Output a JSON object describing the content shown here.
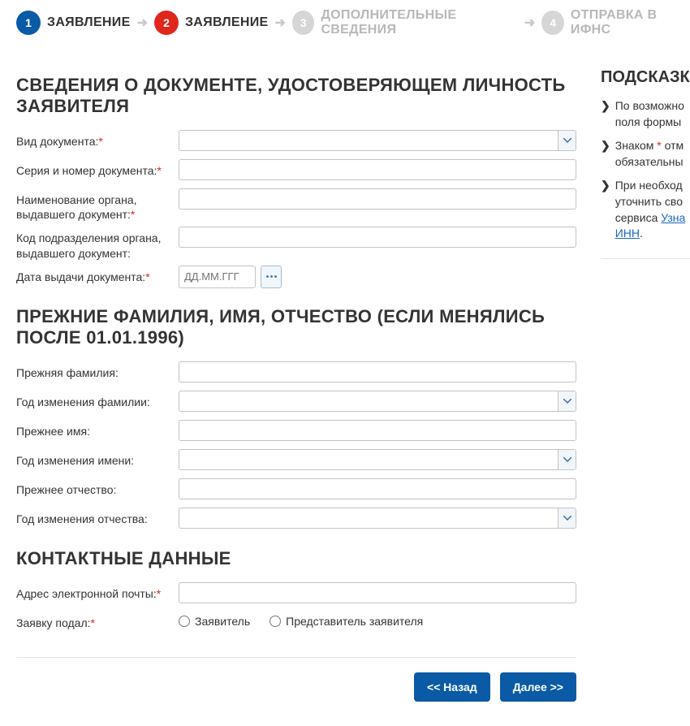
{
  "stepper": {
    "steps": [
      {
        "num": "1",
        "label": "ЗАЯВЛЕНИЕ",
        "circle": "circ-blue",
        "labelCls": "lbl-black"
      },
      {
        "num": "2",
        "label": "ЗАЯВЛЕНИЕ",
        "circle": "circ-red",
        "labelCls": "lbl-black"
      },
      {
        "num": "3",
        "label": "ДОПОЛНИТЕЛЬНЫЕ СВЕДЕНИЯ",
        "circle": "circ-grey",
        "labelCls": "lbl-grey"
      },
      {
        "num": "4",
        "label": "ОТПРАВКА В ИФНС",
        "circle": "circ-grey",
        "labelCls": "lbl-grey"
      }
    ]
  },
  "sections": {
    "doc": {
      "title": "СВЕДЕНИЯ О ДОКУМЕНТЕ, УДОСТОВЕРЯЮЩЕМ ЛИЧНОСТЬ ЗАЯВИТЕЛЯ",
      "fields": {
        "type": {
          "label": "Вид документа:",
          "req": "*"
        },
        "series": {
          "label": "Серия и номер документа:",
          "req": "*"
        },
        "issuer": {
          "label": "Наименование органа, выдавшего документ:",
          "req": "*"
        },
        "code": {
          "label": "Код подразделения органа, выдавшего документ:"
        },
        "date": {
          "label": "Дата выдачи документа:",
          "req": "*",
          "placeholder": "ДД.ММ.ГГГ"
        }
      }
    },
    "prev": {
      "title": "ПРЕЖНИЕ ФАМИЛИЯ, ИМЯ, ОТЧЕСТВО (ЕСЛИ МЕНЯЛИСЬ ПОСЛЕ 01.01.1996)",
      "fields": {
        "surname": {
          "label": "Прежняя фамилия:"
        },
        "surnameYear": {
          "label": "Год изменения фамилии:"
        },
        "name": {
          "label": "Прежнее имя:"
        },
        "nameYear": {
          "label": "Год изменения имени:"
        },
        "patr": {
          "label": "Прежнее отчество:"
        },
        "patrYear": {
          "label": "Год изменения отчества:"
        }
      }
    },
    "contact": {
      "title": "КОНТАКТНЫЕ ДАННЫЕ",
      "fields": {
        "email": {
          "label": "Адрес электронной почты:",
          "req": "*"
        },
        "submitter": {
          "label": "Заявку подал:",
          "req": "*",
          "options": {
            "self": "Заявитель",
            "rep": "Представитель заявителя"
          }
        }
      }
    }
  },
  "nav": {
    "back": "<< Назад",
    "next": "Далее >>"
  },
  "sidebar": {
    "title": "ПОДСКАЗКА",
    "hints": [
      {
        "pre": "По возможно",
        "rest": "поля формы"
      },
      {
        "pre": "Знаком ",
        "star": "*",
        "rest": " отм",
        "line2": "обязательны"
      },
      {
        "pre": "При необход",
        "line2": "уточнить сво",
        "line3_pre": "сервиса ",
        "link1": "Узна",
        "link2": "ИНН",
        "after": "."
      }
    ]
  }
}
